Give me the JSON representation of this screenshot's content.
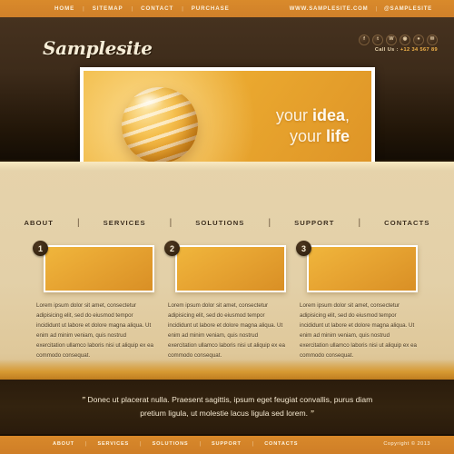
{
  "topbar": {
    "nav": [
      {
        "label": "HOME"
      },
      {
        "label": "SITEMAP"
      },
      {
        "label": "CONTACT"
      },
      {
        "label": "PURCHASE"
      }
    ],
    "separator": "|",
    "site_url": "WWW.SAMPLESITE.COM",
    "social_handle": "@SAMPLESITE"
  },
  "header": {
    "logo": "Samplesite",
    "social_icons": [
      {
        "name": "facebook-icon",
        "glyph": "f"
      },
      {
        "name": "twitter-icon",
        "glyph": "t"
      },
      {
        "name": "wordpress-icon",
        "glyph": "W"
      },
      {
        "name": "rss-icon",
        "glyph": "◉"
      },
      {
        "name": "dribbble-icon",
        "glyph": "●"
      },
      {
        "name": "email-icon",
        "glyph": "✉"
      }
    ],
    "call_us_label": "Call Us :",
    "call_us_number": "+12 34 567 89"
  },
  "hero": {
    "line1_normal": "your ",
    "line1_bold": "idea",
    "line1_tail": ",",
    "line2_normal": "your ",
    "line2_bold": "life",
    "prev_arrow": "‹",
    "next_arrow": "›",
    "dots": [
      {
        "active": true
      },
      {
        "active": false
      },
      {
        "active": false
      }
    ]
  },
  "mainnav": {
    "separator": "|",
    "items": [
      {
        "label": "ABOUT"
      },
      {
        "label": "SERVICES"
      },
      {
        "label": "SOLUTIONS"
      },
      {
        "label": "SUPPORT"
      },
      {
        "label": "CONTACTS"
      }
    ]
  },
  "columns": [
    {
      "number": "1",
      "text": "Lorem ipsum dolor sit amet, consectetur adipisicing elit, sed do eiusmod tempor incididunt ut labore et dolore magna aliqua. Ut enim ad minim veniam, quis nostrud exercitation ullamco laboris nisi ut aliquip ex ea commodo consequat."
    },
    {
      "number": "2",
      "text": "Lorem ipsum dolor sit amet, consectetur adipisicing elit, sed do eiusmod tempor incididunt ut labore et dolore magna aliqua. Ut enim ad minim veniam, quis nostrud exercitation ullamco laboris nisi ut aliquip ex ea commodo consequat."
    },
    {
      "number": "3",
      "text": "Lorem ipsum dolor sit amet, consectetur adipisicing elit, sed do eiusmod tempor incididunt ut labore et dolore magna aliqua. Ut enim ad minim veniam, quis nostrud exercitation ullamco laboris nisi ut aliquip ex ea commodo consequat."
    }
  ],
  "quote": {
    "open_mark": "”",
    "text": "Donec ut placerat nulla. Praesent sagittis, ipsum eget feugiat convallis, purus diam pretium ligula, ut molestie lacus ligula sed lorem.",
    "close_mark": "”"
  },
  "footer": {
    "separator": "|",
    "nav": [
      {
        "label": "ABOUT"
      },
      {
        "label": "SERVICES"
      },
      {
        "label": "SOLUTIONS"
      },
      {
        "label": "SUPPORT"
      },
      {
        "label": "CONTACTS"
      }
    ],
    "copyright": "Copyright © 2013"
  },
  "colors": {
    "accent_orange": "#d98a2b",
    "hero_orange": "#eaa82f",
    "dark_brown": "#3d2b1a",
    "cream": "#e3d0a8",
    "quote_bg": "#2b1c0c"
  }
}
